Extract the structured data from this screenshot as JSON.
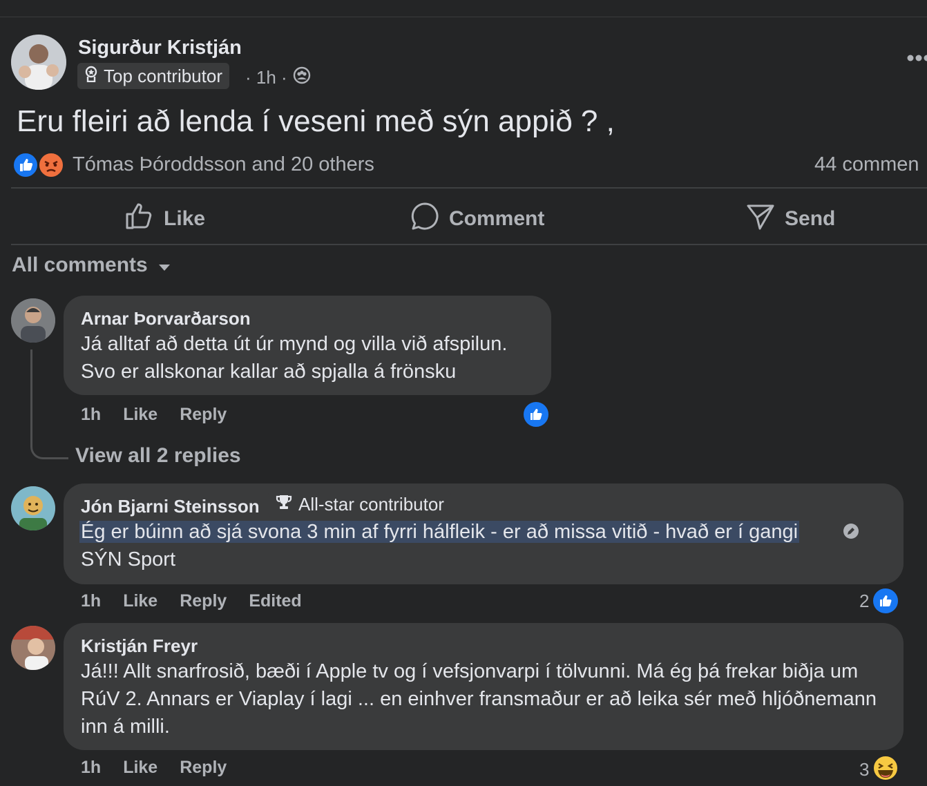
{
  "post": {
    "author": "Sigurður Kristján",
    "badge": "Top contributor",
    "time": "· 1h ·",
    "text": "Eru fleiri að lenda í veseni með sýn appið ? ,",
    "reactions_text": "Tómas Þóroddsson and 20 others",
    "comments_count": "44 commen"
  },
  "actions": {
    "like": "Like",
    "comment": "Comment",
    "send": "Send"
  },
  "filter_label": "All comments",
  "comments": [
    {
      "author": "Arnar Þorvarðarson",
      "text": "Já alltaf að detta út úr mynd og villa við afspilun. Svo er allskonar kallar að spjalla á frönsku",
      "time": "1h",
      "like": "Like",
      "reply": "Reply",
      "view_replies": "View all 2 replies"
    },
    {
      "author": "Jón Bjarni Steinsson",
      "badge": "All-star contributor",
      "text_highlighted": "Ég er búinn að sjá svona 3 min af fyrri hálfleik - er að missa vitið - hvað er í gangi",
      "text_rest": "SÝN Sport",
      "time": "1h",
      "like": "Like",
      "reply": "Reply",
      "edited": "Edited",
      "reaction_count": "2"
    },
    {
      "author": "Kristján Freyr",
      "text": "Já!!! Allt snarfrosið, bæði í Apple tv og í vefsjonvarpi í tölvunni. Má ég þá frekar biðja um RúV 2. Annars er Viaplay í lagi ... en einhver fransmaður er að leika sér með hljóðnemann inn á milli.",
      "time": "1h",
      "like": "Like",
      "reply": "Reply",
      "reaction_count": "3"
    }
  ],
  "colors": {
    "background": "#242526",
    "bubble": "#3a3b3c",
    "text_primary": "#e4e6eb",
    "text_secondary": "#b0b3b8",
    "like_blue": "#1877f2",
    "selection": "#3b4a63"
  }
}
